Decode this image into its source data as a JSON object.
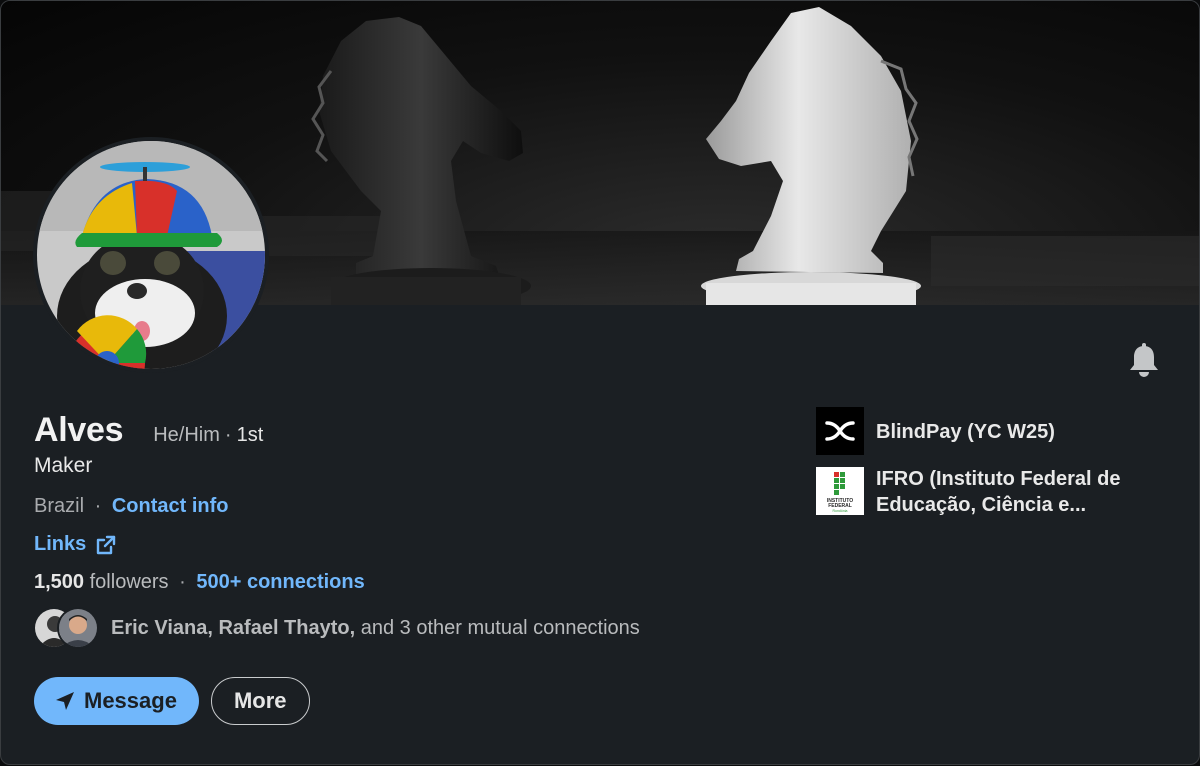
{
  "profile": {
    "name": "Alves",
    "pronouns": "He/Him",
    "degree_separator": "·",
    "degree": "1st",
    "headline": "Maker",
    "location": "Brazil",
    "location_separator": "·",
    "contact_info_label": "Contact info",
    "links_label": "Links",
    "followers_count": "1,500",
    "followers_label": "followers",
    "connections_separator": "·",
    "connections_label": "500+ connections",
    "mutual_names": "Eric Viana, Rafael Thayto,",
    "mutual_rest": "and 3 other mutual connections"
  },
  "actions": {
    "message_label": "Message",
    "more_label": "More"
  },
  "experience": [
    {
      "name": "BlindPay (YC W25)",
      "logo": "blindpay-logo"
    },
    {
      "name": "IFRO (Instituto Federal de Educação, Ciência e...",
      "logo": "ifro-logo"
    }
  ],
  "ifro_logo_text": [
    "INSTITUTO",
    "FEDERAL",
    "Rondônia"
  ],
  "icons": {
    "bell": "bell-icon",
    "external_link": "external-link-icon",
    "send": "send-icon"
  },
  "colors": {
    "accent": "#71b7fb",
    "card_bg": "#1b1f23",
    "text_primary": "#e9e9e9",
    "text_secondary": "#b9bbbd"
  }
}
